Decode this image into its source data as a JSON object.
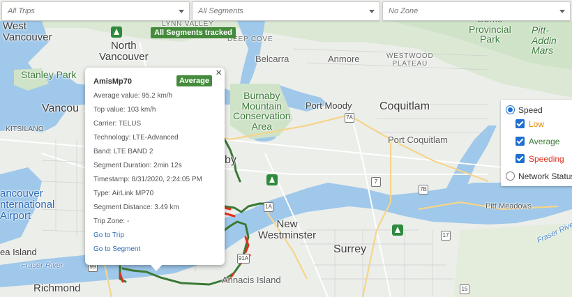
{
  "filters": {
    "trips": "All Trips",
    "segments": "All Segments",
    "zone": "No Zone"
  },
  "badge": "All Segments tracked",
  "popup": {
    "title": "AmisMp70",
    "level": "Average",
    "close_icon": "×",
    "rows": [
      "Average value: 95.2 km/h",
      "Top value: 103 km/h",
      "Carrier: TELUS",
      "Technology: LTE-Advanced",
      "Band: LTE BAND 2",
      "Segment Duration: 2min 12s",
      "Timestamp: 8/31/2020, 2:24:05 PM",
      "Type: AirLink MP70",
      "Segment Distance: 3.49 km",
      "Trip Zone: -"
    ],
    "go_trip": "Go to Trip",
    "go_segment": "Go to Segment"
  },
  "legend": {
    "speed": "Speed",
    "low": "Low",
    "average": "Average",
    "speeding": "Speeding",
    "network": "Network Status",
    "colors": {
      "low": "#e08a00",
      "average": "#3a7a35",
      "speeding": "#e0311f"
    }
  },
  "map": {
    "labels": {
      "west_vancouver": "West\nVancouver",
      "north_vancouver": "North\nVancouver",
      "stanley_park": "Stanley Park",
      "vancouver": "Vancou",
      "kitsilano": "KITSILANO",
      "vancouver_intl": "ancouver\nnternational\nAirport",
      "sea_island": "ea Island",
      "fraser_river_w": "Fraser River",
      "richmond": "Richmond",
      "lynn_valley": "LYNN VALLEY",
      "deep_cove": "DEEP COVE",
      "belcarra": "Belcarra",
      "anmore": "Anmore",
      "westwood": "WESTWOOD\nPLATEAU",
      "burke": "Burke\nProvincial\nPark",
      "pitt_addington": "Pitt-Addin\nMars",
      "burnaby_mtn": "Burnaby\nMountain\nConservation\nArea",
      "port_moody": "Port Moody",
      "coquitlam": "Coquitlam",
      "port_coquitlam": "Port Coquitlam",
      "burnaby": "by",
      "new_westminster": "New\nWestminster",
      "surrey": "Surrey",
      "annacis": "Annacis Island",
      "pitt_meadows": "Pitt Meadows",
      "fraser_river_e": "Fraser River"
    },
    "shields": {
      "r7a": "7A",
      "r7": "7",
      "r7b": "7B",
      "r1a": "1A",
      "r91a": "91A",
      "r99": "99",
      "r17": "17",
      "r15": "15"
    }
  }
}
